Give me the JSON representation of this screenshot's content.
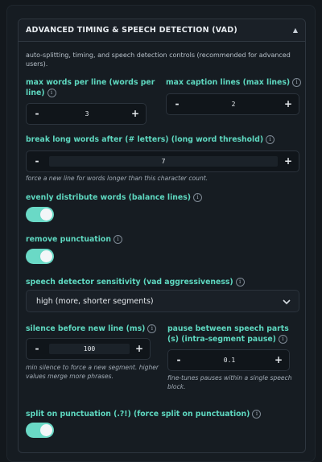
{
  "section": {
    "title": "ADVANCED TIMING & SPEECH DETECTION (VAD)",
    "collapse_icon": "chevron-up-icon",
    "description": "auto-splitting, timing, and speech detection controls (recommended for advanced users)."
  },
  "max_words": {
    "label": "max words per line (words per line)",
    "value": "3"
  },
  "max_lines": {
    "label": "max caption lines (max lines)",
    "value": "2"
  },
  "long_word": {
    "label": "break long words after (# letters) (long word threshold)",
    "value": "7",
    "hint": "force a new line for words longer than this character count."
  },
  "balance": {
    "label": "evenly distribute words (balance lines)",
    "on": true
  },
  "punct": {
    "label": "remove punctuation",
    "on": true
  },
  "vad": {
    "label": "speech detector sensitivity (vad aggressiveness)",
    "selected": "high (more, shorter segments)"
  },
  "silence": {
    "label": "silence before new line (ms)",
    "value": "100",
    "hint": "min silence to force a new segment. higher values merge more phrases."
  },
  "pause": {
    "label": "pause between speech parts (s) (intra-segment pause)",
    "value": "0.1",
    "hint": "fine-tunes pauses within a single speech block."
  },
  "split": {
    "label": "split on punctuation (.?!) (force split on punctuation)",
    "on": true
  },
  "buttons": {
    "minus": "-",
    "plus": "+",
    "info": "i"
  },
  "colors": {
    "accent": "#5ed8c0",
    "toggle_on": "#6ad9c6",
    "background": "#161c22"
  }
}
